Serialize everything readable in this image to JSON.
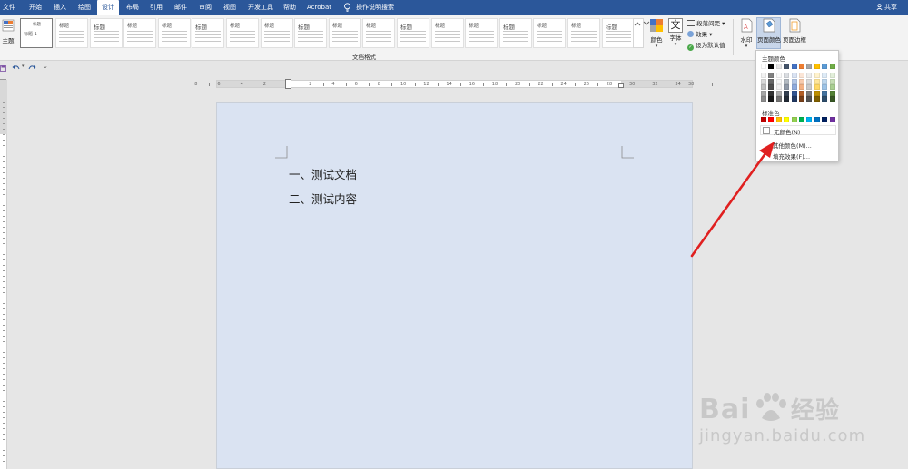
{
  "tabs": [
    {
      "label": "文件"
    },
    {
      "label": "开始"
    },
    {
      "label": "插入"
    },
    {
      "label": "绘图"
    },
    {
      "label": "设计"
    },
    {
      "label": "布局"
    },
    {
      "label": "引用"
    },
    {
      "label": "邮件"
    },
    {
      "label": "审阅"
    },
    {
      "label": "视图"
    },
    {
      "label": "开发工具"
    },
    {
      "label": "帮助"
    },
    {
      "label": "Acrobat"
    },
    {
      "label": "操作说明搜索"
    }
  ],
  "share_label": "共享",
  "ribbon": {
    "theme_label": "主题",
    "gallery_first_title": "标题",
    "gallery_first_sub": "标题 1",
    "gallery_titles": [
      "标题",
      "标题",
      "标题",
      "标题",
      "标题",
      "标题",
      "标题",
      "标题",
      "标题",
      "标题",
      "标题",
      "标题",
      "标题",
      "标题",
      "标题",
      "标题",
      "标题"
    ],
    "group_label": "文档格式",
    "colors_label": "颜色",
    "fonts_label": "字体",
    "paragraph_spacing_label": "段落间距",
    "effects_label": "效果",
    "set_default_label": "设为默认值",
    "watermark_label": "水印",
    "page_color_label": "页面颜色",
    "page_border_label": "页面边框"
  },
  "ruler_numbers": [
    "8",
    "6",
    "4",
    "2",
    "2",
    "4",
    "6",
    "8",
    "10",
    "12",
    "14",
    "16",
    "18",
    "20",
    "22",
    "24",
    "26",
    "28",
    "30",
    "32",
    "34",
    "38"
  ],
  "document": {
    "lines": [
      "一、测试文档",
      "二、测试内容"
    ]
  },
  "dropdown": {
    "theme_colors_label": "主题颜色",
    "standard_colors_label": "标准色",
    "no_color_label": "无颜色(N)",
    "more_colors_label": "其他颜色(M)...",
    "fill_effects_label": "填充效果(F)...",
    "theme_top_row": [
      "#ffffff",
      "#000000",
      "#e7e6e6",
      "#44546a",
      "#4472c4",
      "#ed7d31",
      "#a5a5a5",
      "#ffc000",
      "#5b9bd5",
      "#70ad47"
    ],
    "standard_row": [
      "#c00000",
      "#ff0000",
      "#ffc000",
      "#ffff00",
      "#92d050",
      "#00b050",
      "#00b0f0",
      "#0070c0",
      "#002060",
      "#7030a0"
    ]
  },
  "watermark": {
    "big": "Bai",
    "cn": "经验",
    "url": "jingyan.baidu.com"
  },
  "colors": {
    "accent": "#2b579a",
    "page_fill": "#dae3f2",
    "arrow": "#e02020"
  }
}
